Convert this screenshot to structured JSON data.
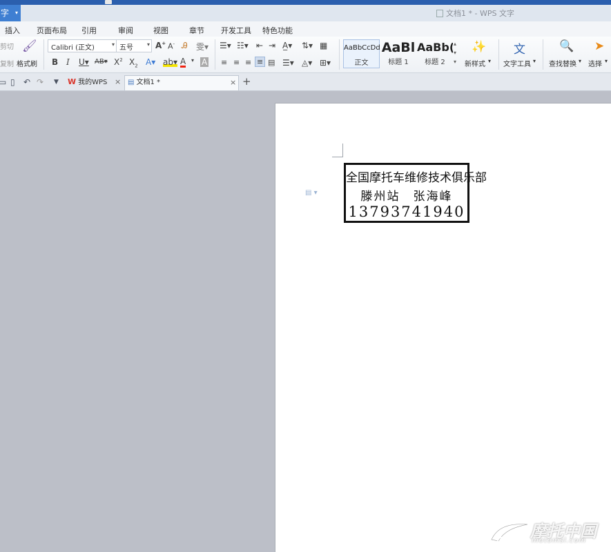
{
  "app": {
    "menu_button_label": "字",
    "window_title": "文档1 * - WPS 文字"
  },
  "menu": {
    "items": [
      "插入",
      "页面布局",
      "引用",
      "审阅",
      "视图",
      "章节",
      "开发工具",
      "特色功能"
    ]
  },
  "ribbon": {
    "cut_label": "剪切",
    "copy_label": "复制",
    "format_painter_label": "格式刷",
    "font_name": "Calibri (正文)",
    "font_size": "五号",
    "styles": [
      {
        "sample": "AaBbCcDd",
        "label": "正文"
      },
      {
        "sample": "AaBl",
        "label": "标题 1"
      },
      {
        "sample": "AaBb(",
        "label": "标题 2"
      }
    ],
    "new_style_label": "新样式",
    "text_tools_label": "文字工具",
    "find_replace_label": "查找替换",
    "select_label": "选择"
  },
  "tabs": {
    "items": [
      {
        "label": "我的WPS",
        "active": false
      },
      {
        "label": "文档1 *",
        "active": true
      }
    ]
  },
  "document": {
    "stamp_line1": "全国摩托车维修技术俱乐部",
    "stamp_line2": "滕州站　张海峰",
    "stamp_line3": "13793741940"
  },
  "watermark": {
    "brand": "摩托中国",
    "url": "motomsl.com"
  },
  "colors": {
    "accent_blue": "#2b5fae",
    "app_button": "#3f7fd2",
    "workspace_gray": "#bcbfc8",
    "wps_red": "#d9352b"
  }
}
